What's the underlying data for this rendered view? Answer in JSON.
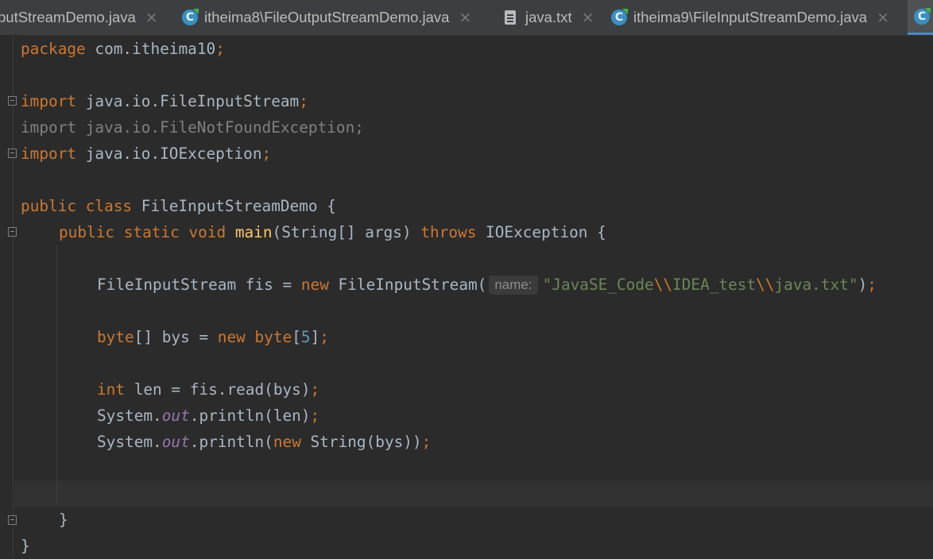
{
  "tabs": [
    {
      "label": "putStreamDemo.java",
      "icon": "java-class-icon"
    },
    {
      "label": "itheima8\\FileOutputStreamDemo.java",
      "icon": "java-class-icon"
    },
    {
      "label": "java.txt",
      "icon": "text-file-icon"
    },
    {
      "label": "itheima9\\FileInputStreamDemo.java",
      "icon": "java-class-icon"
    },
    {
      "label": "",
      "icon": "java-class-icon",
      "active": true
    }
  ],
  "icons": {
    "class": "C",
    "close": "×"
  },
  "colors": {
    "background": "#2b2b2b",
    "keyword": "#cc7832",
    "method": "#ffc66d",
    "string": "#6a8759",
    "number": "#6897bb",
    "field": "#9876aa",
    "text": "#a9b7c6",
    "unused": "#808080"
  },
  "code": {
    "l1": {
      "kw": "package",
      "pkg": " com.itheima10",
      "semi": ";"
    },
    "l3": {
      "kw": "import",
      "rest": " java.io.FileInputStream",
      "semi": ";"
    },
    "l4": {
      "text": "import java.io.FileNotFoundException;"
    },
    "l5": {
      "kw": "import",
      "rest": " java.io.IOException",
      "semi": ";"
    },
    "l7": {
      "kw": "public class",
      "rest": " FileInputStreamDemo {"
    },
    "l8": {
      "kw1": "public static void",
      "fn": "main",
      "mid": "(String[] args) ",
      "kw2": "throws",
      "rest": " IOException {"
    },
    "l10": {
      "t1": "FileInputStream fis = ",
      "kw": "new",
      "t2": " FileInputStream(",
      "hint": "name:",
      "s1": "\"JavaSE_Code",
      "e1": "\\\\",
      "s2": "IDEA_test",
      "e2": "\\\\",
      "s3": "java.txt\"",
      "t3": ")",
      "semi": ";"
    },
    "l12": {
      "kw1": "byte",
      "t1": "[] bys = ",
      "kw2": "new",
      "kw3": " byte",
      "t2": "[",
      "num": "5",
      "t3": "]",
      "semi": ";"
    },
    "l14": {
      "kw": "int",
      "t1": " len = fis.read(bys)",
      "semi": ";"
    },
    "l15": {
      "t1": "System.",
      "fld": "out",
      "t2": ".println(len)",
      "semi": ";"
    },
    "l16": {
      "t1": "System.",
      "fld": "out",
      "t2": ".println(",
      "kw": "new",
      "t3": " String(bys))",
      "semi": ";"
    },
    "l19": {
      "text": "}"
    },
    "l20": {
      "text": "}"
    }
  }
}
